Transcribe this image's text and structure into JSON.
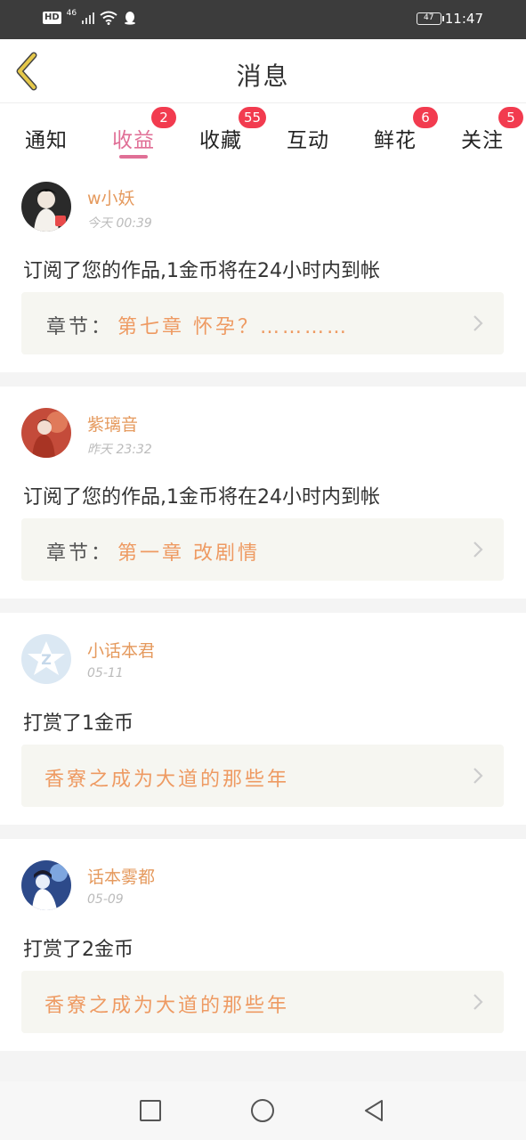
{
  "status_bar": {
    "hd": "HD",
    "network": "46",
    "battery": "47",
    "time": "11:47"
  },
  "header": {
    "title": "消息"
  },
  "tabs": [
    {
      "label": "通知",
      "badge": ""
    },
    {
      "label": "收益",
      "badge": "2"
    },
    {
      "label": "收藏",
      "badge": "55"
    },
    {
      "label": "互动",
      "badge": ""
    },
    {
      "label": "鲜花",
      "badge": "6"
    },
    {
      "label": "关注",
      "badge": "5"
    }
  ],
  "active_tab": "收益",
  "messages": [
    {
      "username": "w小妖",
      "time": "今天 00:39",
      "text": "订阅了您的作品,1金币将在24小时内到帐",
      "link_prefix": "章节：",
      "link_text": "第七章 怀孕？…………"
    },
    {
      "username": "紫璃音",
      "time": "昨天 23:32",
      "text": "订阅了您的作品,1金币将在24小时内到帐",
      "link_prefix": "章节：",
      "link_text": "第一章 改剧情"
    },
    {
      "username": "小话本君",
      "time": "05-11",
      "text": "打赏了1金币",
      "link_prefix": "",
      "link_text": "香寮之成为大道的那些年"
    },
    {
      "username": "话本雾都",
      "time": "05-09",
      "text": "打赏了2金币",
      "link_prefix": "",
      "link_text": "香寮之成为大道的那些年"
    }
  ],
  "colors": {
    "accent": "#e06f96",
    "username": "#e59a5e",
    "link": "#ee9a62",
    "badge": "#f23b4f",
    "back_arrow": "#e5c84a"
  }
}
